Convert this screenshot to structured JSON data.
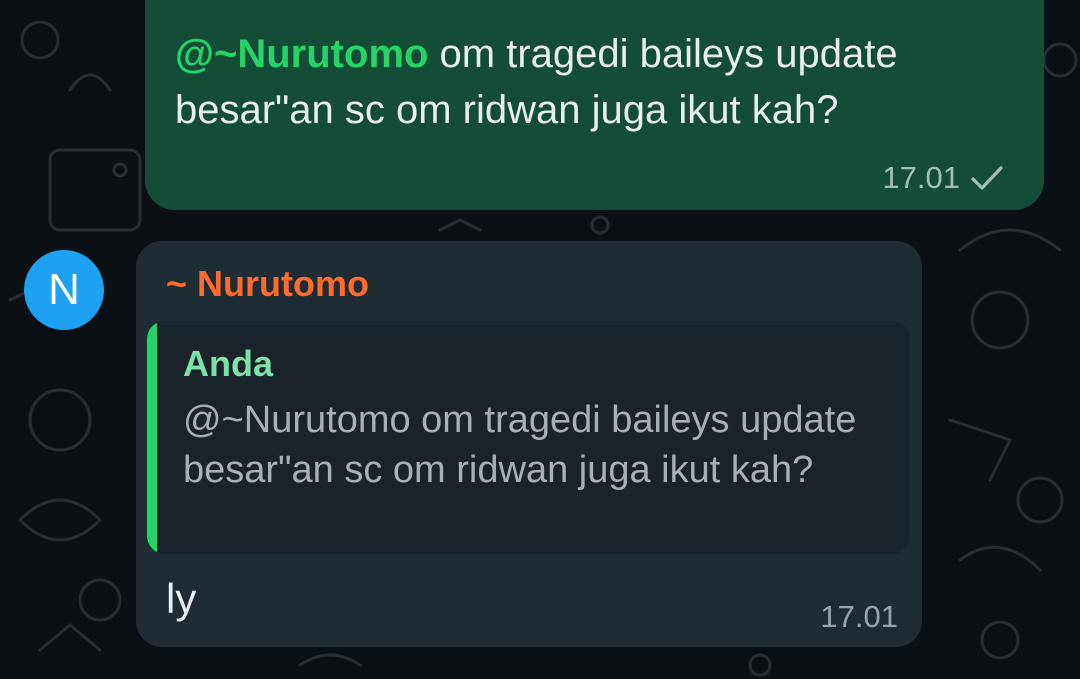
{
  "sent_message": {
    "mention": "@~Nurutomo",
    "text": " om tragedi baileys update besar\"an sc om ridwan juga ikut kah?",
    "time": "17.01",
    "status_icon": "single-check-icon"
  },
  "received_message": {
    "avatar_letter": "N",
    "sender": "~ Nurutomo",
    "quote": {
      "author": "Anda",
      "text": "@~Nurutomo om tragedi baileys update besar\"an sc om ridwan juga ikut kah?"
    },
    "text": "ly",
    "time": "17.01"
  },
  "colors": {
    "outgoing_bubble": "#144d37",
    "incoming_bubble": "#202c33",
    "mention": "#25d366",
    "sender_name": "#ff6b2d",
    "quote_author": "#7ee2a8",
    "avatar": "#1da1f2"
  }
}
